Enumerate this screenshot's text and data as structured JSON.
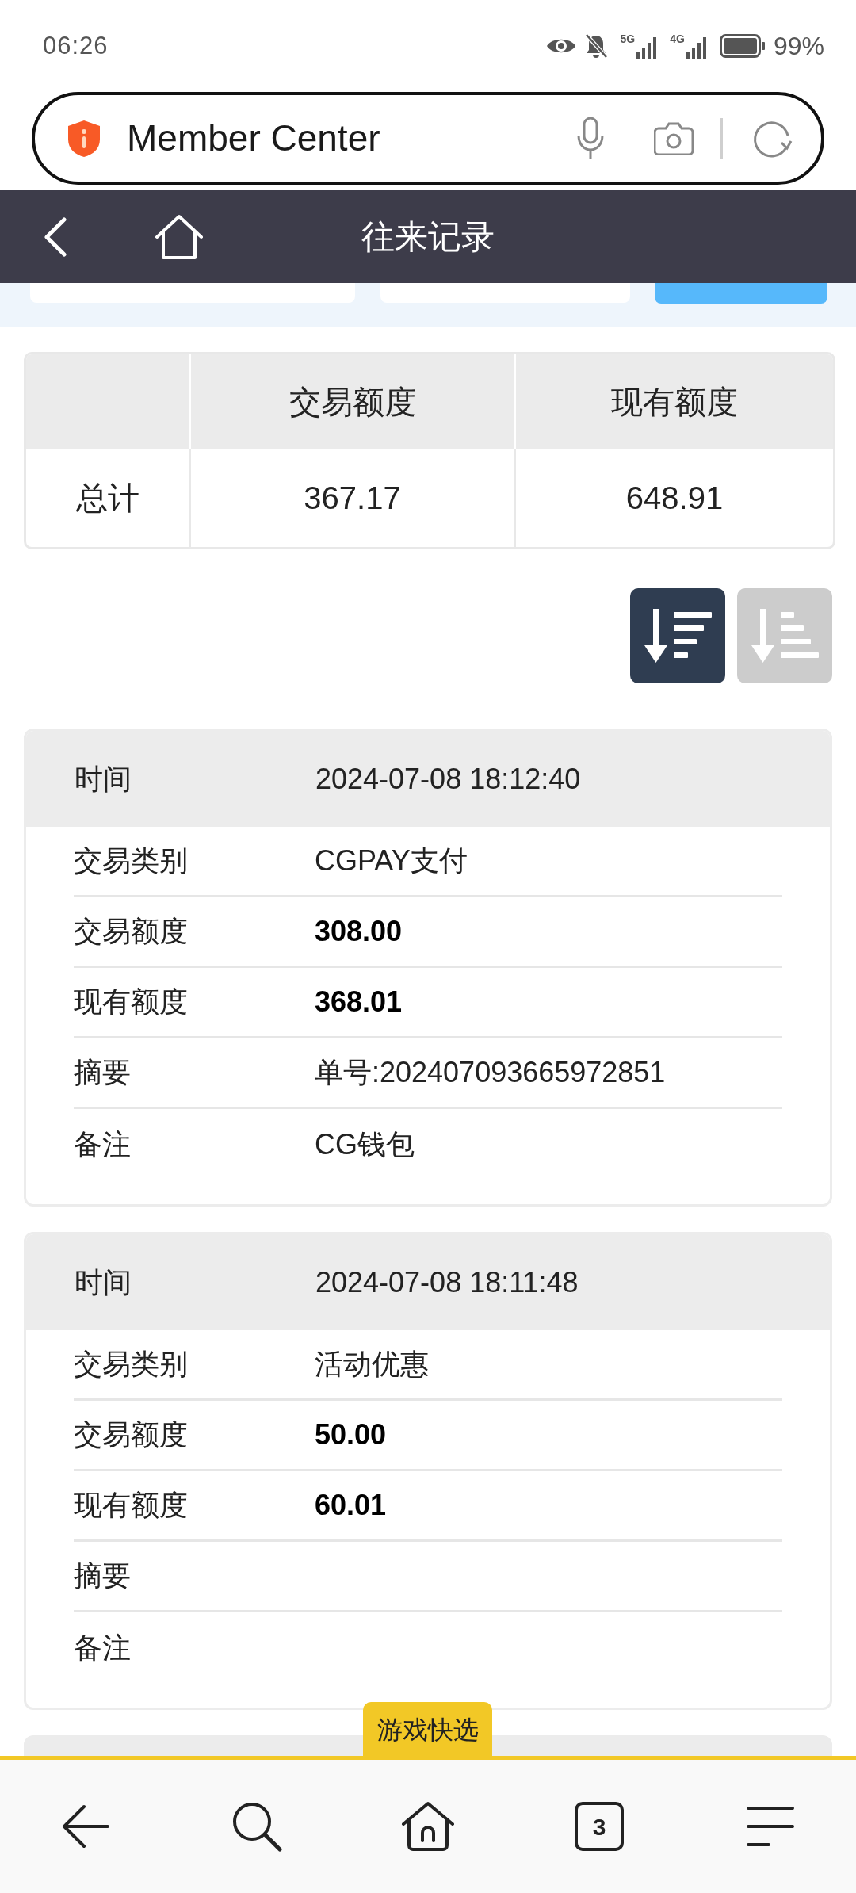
{
  "status_bar": {
    "time": "06:26",
    "network_labels": [
      "5G",
      "4G"
    ],
    "battery": "99%"
  },
  "address_bar": {
    "title": "Member Center"
  },
  "header": {
    "title": "往来记录"
  },
  "summary": {
    "columns": [
      "交易额度",
      "现有额度"
    ],
    "rows": [
      {
        "label": "总计",
        "values": [
          "367.17",
          "648.91"
        ]
      }
    ]
  },
  "sort_buttons": [
    {
      "kind": "descending",
      "selected": true
    },
    {
      "kind": "ascending",
      "selected": false
    }
  ],
  "records": [
    {
      "fields": [
        {
          "kind": "header",
          "label": "时间",
          "value": "2024-07-08 18:12:40"
        },
        {
          "kind": "text",
          "label": "交易类别",
          "value": "CGPAY支付"
        },
        {
          "kind": "amount",
          "label": "交易额度",
          "value": "308.00"
        },
        {
          "kind": "amount",
          "label": "现有额度",
          "value": "368.01"
        },
        {
          "kind": "text",
          "label": "摘要",
          "value": "单号:202407093665972851"
        },
        {
          "kind": "text",
          "label": "备注",
          "value": "CG钱包"
        }
      ]
    },
    {
      "fields": [
        {
          "kind": "header",
          "label": "时间",
          "value": "2024-07-08 18:11:48"
        },
        {
          "kind": "text",
          "label": "交易类别",
          "value": "活动优惠"
        },
        {
          "kind": "amount",
          "label": "交易额度",
          "value": "50.00"
        },
        {
          "kind": "amount",
          "label": "现有额度",
          "value": "60.01"
        },
        {
          "kind": "text",
          "label": "摘要"
        },
        {
          "kind": "text",
          "label": "备注"
        }
      ]
    }
  ],
  "quick_tab": {
    "label": "游戏快选"
  },
  "bottom_nav": {
    "tab_count": "3"
  }
}
